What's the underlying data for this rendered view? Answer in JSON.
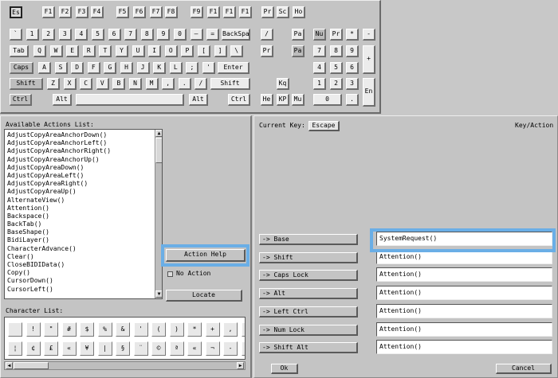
{
  "keyboard": {
    "fn_row": [
      "Es",
      "F1",
      "F2",
      "F3",
      "F4",
      "F5",
      "F6",
      "F7",
      "F8",
      "F9",
      "F1",
      "F1",
      "F1",
      "Pr",
      "Sc",
      "Ho"
    ],
    "row1": [
      "`",
      "1",
      "2",
      "3",
      "4",
      "5",
      "6",
      "7",
      "8",
      "9",
      "0",
      "—",
      "=",
      "BackSpa"
    ],
    "row1_nav": [
      "/",
      "Pa"
    ],
    "row1_pad": [
      "Nu",
      "Pr",
      "*",
      "-"
    ],
    "row2": [
      "Tab",
      "Q",
      "W",
      "E",
      "R",
      "T",
      "Y",
      "U",
      "I",
      "O",
      "P",
      "[",
      "]",
      "\\"
    ],
    "row2_nav": [
      "Pr",
      "Pa"
    ],
    "row2_pad": [
      "7",
      "8",
      "9"
    ],
    "pad_plus": "+",
    "row3": [
      "Caps",
      "A",
      "S",
      "D",
      "F",
      "G",
      "H",
      "J",
      "K",
      "L",
      ";",
      "'",
      "Enter"
    ],
    "row3_pad": [
      "4",
      "5",
      "6"
    ],
    "row4": [
      "Shift",
      "Z",
      "X",
      "C",
      "V",
      "B",
      "N",
      "M",
      ",",
      ".",
      "/",
      "Shift"
    ],
    "row4_nav": [
      "Kq"
    ],
    "row4_pad": [
      "1",
      "2",
      "3"
    ],
    "pad_enter": "En",
    "row5_left": [
      "Ctrl",
      "Alt"
    ],
    "row5_right": [
      "Alt",
      "Ctrl"
    ],
    "row5_nav": [
      "He",
      "KP",
      "Mu"
    ],
    "row5_pad": [
      "0",
      "."
    ]
  },
  "actions": {
    "title": "Available Actions List:",
    "items": [
      "AdjustCopyAreaAnchorDown()",
      "AdjustCopyAreaAnchorLeft()",
      "AdjustCopyAreaAnchorRight()",
      "AdjustCopyAreaAnchorUp()",
      "AdjustCopyAreaDown()",
      "AdjustCopyAreaLeft()",
      "AdjustCopyAreaRight()",
      "AdjustCopyAreaUp()",
      "AlternateView()",
      "Attention()",
      "Backspace()",
      "BackTab()",
      "BaseShape()",
      "BidiLayer()",
      "CharacterAdvance()",
      "Clear()",
      "CloseBIDIData()",
      "Copy()",
      "CursorDown()",
      "CursorLeft()"
    ],
    "action_help_label": "Action Help",
    "no_action_label": "No Action",
    "locate_label": "Locate"
  },
  "characters": {
    "title": "Character List:",
    "row1": [
      "",
      "!",
      "\"",
      "#",
      "$",
      "%",
      "&",
      "'",
      "(",
      ")",
      "*",
      "+",
      ",",
      "-"
    ],
    "row2": [
      "¦",
      "¢",
      "£",
      "«",
      "¥",
      "|",
      "§",
      "¨",
      "©",
      "ª",
      "«",
      "¬",
      "-",
      "®"
    ]
  },
  "key_action": {
    "current_key_label": "Current Key:",
    "current_key_value": "Escape",
    "title": "Key/Action",
    "rows": [
      {
        "modifier": "-> Base",
        "action": "SystemRequest()"
      },
      {
        "modifier": "-> Shift",
        "action": "Attention()"
      },
      {
        "modifier": "-> Caps Lock",
        "action": "Attention()"
      },
      {
        "modifier": "-> Alt",
        "action": "Attention()"
      },
      {
        "modifier": "-> Left Ctrl",
        "action": "Attention()"
      },
      {
        "modifier": "-> Num Lock",
        "action": "Attention()"
      },
      {
        "modifier": "-> Shift Alt",
        "action": "Attention()"
      }
    ],
    "ok_label": "Ok",
    "cancel_label": "Cancel"
  },
  "colors": {
    "highlight": "#6aaee6"
  }
}
